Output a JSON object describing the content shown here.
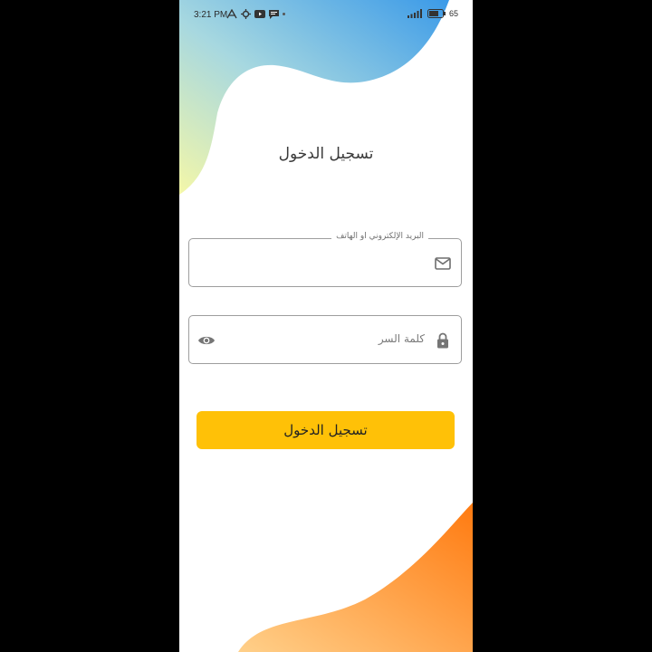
{
  "status_bar": {
    "time": "3:21 PM",
    "battery": "65"
  },
  "login": {
    "title": "تسجيل الدخول",
    "email_label": "البريد الإلكتروني او الهاتف",
    "email_value": "",
    "password_placeholder": "كلمة السر",
    "submit_label": "تسجيل الدخول"
  },
  "icons": {
    "email": "mail-icon",
    "password": "lock-icon",
    "toggle_visibility": "eye-icon"
  },
  "colors": {
    "primary_button": "#ffc107",
    "top_gradient_start": "#f4f7a8",
    "top_gradient_end": "#3b9ae8",
    "bottom_gradient_start": "#ffd08a",
    "bottom_gradient_end": "#ff7a10"
  }
}
